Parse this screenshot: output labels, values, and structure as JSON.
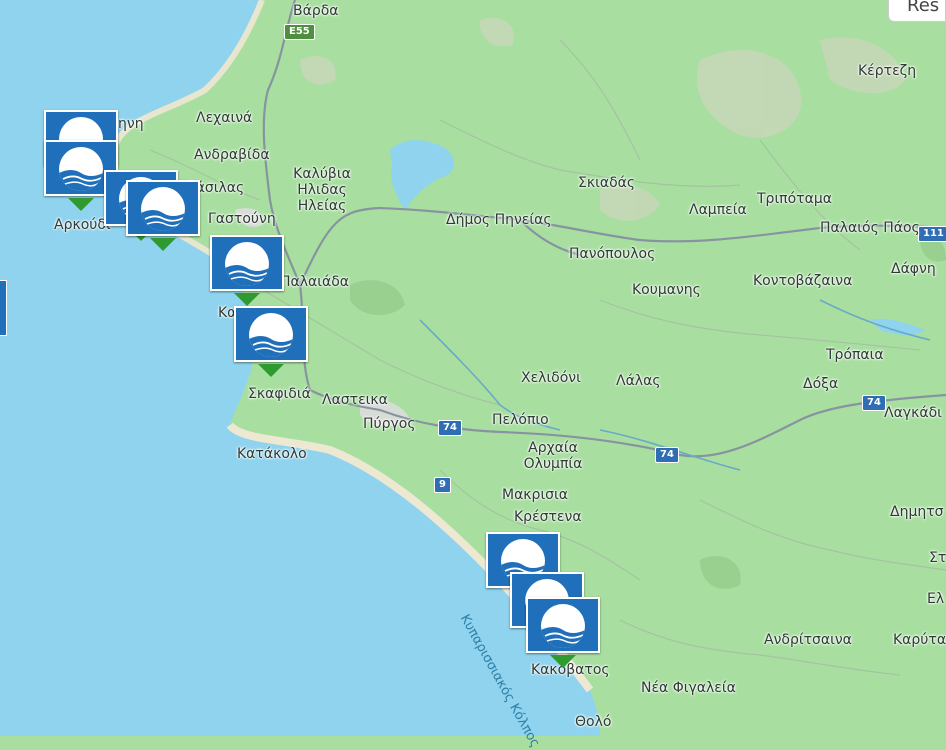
{
  "header": {
    "button_label": "Res"
  },
  "colors": {
    "sea": "#8fd3ee",
    "land": "#a8dfa0",
    "flag": "#1f6fba",
    "pin": "#2f9a2f",
    "road": "#8794a0"
  },
  "places": [
    "Βάρδα",
    "Κέρτεζη",
    "Λεχαινά",
    "Ανδραβίδα",
    "Καλύβια Ηλιδας Ηλείας",
    "Βάσιλας",
    "Σκιαδάς",
    "Λαμπεία",
    "Τριπόταμα",
    "Παλαιός Πάος",
    "Δήμος Πηνείας",
    "Πανόπουλος",
    "Δάφνη",
    "Κουμανης",
    "Κοντοβάζαινα",
    "Αρκούδι",
    "Γαστούνη",
    "Παλαιάδα",
    "Κα",
    "Τρόπαια",
    "Χελιδόνι",
    "Λάλας",
    "Δόξα",
    "Σκαφιδιά",
    "Λαστεικα",
    "Λαγκάδι",
    "Πελόπιο",
    "Πύργος",
    "Αρχαία Ολυμπία",
    "Κατάκολο",
    "Μακρισια",
    "Κρέστενα",
    "Δημητσ",
    "Στ",
    "Ελ",
    "Ανδρίτσαινα",
    "Καρύτα",
    "Κακόβατος",
    "Νέα Φιγαλεία",
    "Θολό",
    "ηνη"
  ],
  "sea_label": "Κυπαρισσιακός Κόλπος",
  "road_shields": [
    "E55",
    "74",
    "74",
    "74",
    "9",
    "111"
  ],
  "markers": [
    {
      "name": "Αρκούδι"
    },
    {
      "name": "Αρκούδι"
    },
    {
      "name": "Γαστούνη"
    },
    {
      "name": "Γαστούνη"
    },
    {
      "name": "Κουρούτα"
    },
    {
      "name": "Σκαφιδιά"
    },
    {
      "name": "Κακόβατος"
    },
    {
      "name": "Κακόβατος"
    },
    {
      "name": "Κακόβατος"
    }
  ]
}
